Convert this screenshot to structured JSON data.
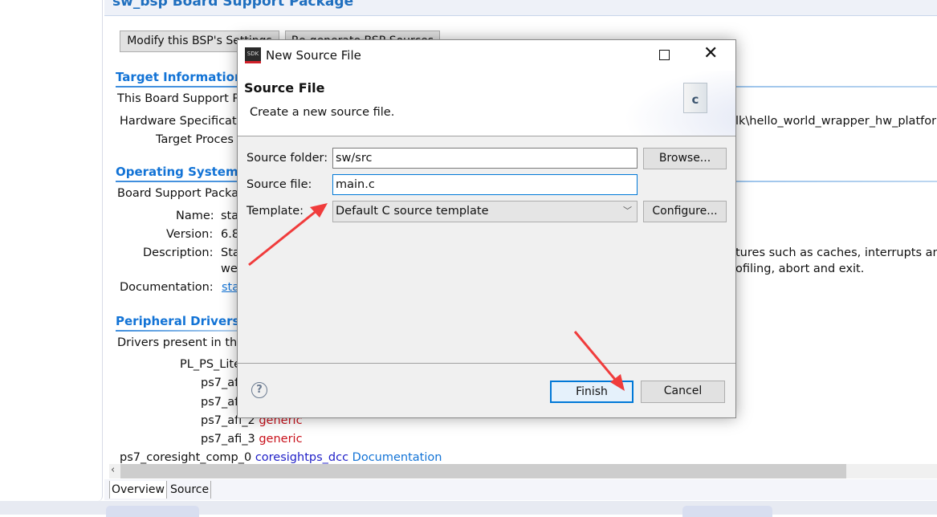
{
  "editor": {
    "title": "sw_bsp Board Support Package",
    "buttons": {
      "modify": "Modify this BSP's Settings",
      "regenerate": "Re-generate BSP Sources"
    },
    "target": {
      "heading": "Target Information",
      "intro": "This Board Support P",
      "hw_label": "Hardware Specificat",
      "hw_value_tail": "lk\\hello_world_wrapper_hw_platfor",
      "proc_label": "Target Proces"
    },
    "os": {
      "heading": "Operating System",
      "intro": "Board Support Packa",
      "name_label": "Name:",
      "name_value": "sta",
      "version_label": "Version:",
      "version_value": "6.8",
      "desc_label": "Description:",
      "desc_value1": "Sta",
      "desc_value2": "we",
      "desc_tail1": "tures such as caches, interrupts and",
      "desc_tail2": "ofiling, abort and exit.",
      "doc_label": "Documentation:",
      "doc_value": "sta"
    },
    "drivers": {
      "heading": "Peripheral Drivers",
      "intro": "Drivers present in the",
      "group": "PL_PS_Lite",
      "items": [
        {
          "name": "ps7_af",
          "driver": ""
        },
        {
          "name": "ps7_af",
          "driver": ""
        },
        {
          "name": "ps7_afi_2",
          "driver": "generic"
        },
        {
          "name": "ps7_afi_3",
          "driver": "generic"
        }
      ],
      "last": {
        "name": "ps7_coresight_comp_0",
        "driver": "coresightps_dcc",
        "doc": "Documentation"
      }
    },
    "tabs": [
      {
        "label": "Overview",
        "active": true
      },
      {
        "label": "Source",
        "active": false
      }
    ]
  },
  "dialog": {
    "title": "New Source File",
    "app_icon": "SDK",
    "heading": "Source File",
    "subtitle": "Create a new source file.",
    "source_folder_label": "Source folder:",
    "source_folder_value": "sw/src",
    "source_file_label": "Source file:",
    "source_file_value": "main.c",
    "template_label": "Template:",
    "template_value": "Default C source template",
    "browse": "Browse...",
    "configure": "Configure...",
    "finish": "Finish",
    "cancel": "Cancel",
    "icons": [
      "maximize-icon",
      "close-icon",
      "c-file-icon",
      "help-icon"
    ]
  },
  "colors": {
    "accent": "#1273d6",
    "annotation_arrow": "#f03c3c",
    "generic": "#c8101a"
  }
}
